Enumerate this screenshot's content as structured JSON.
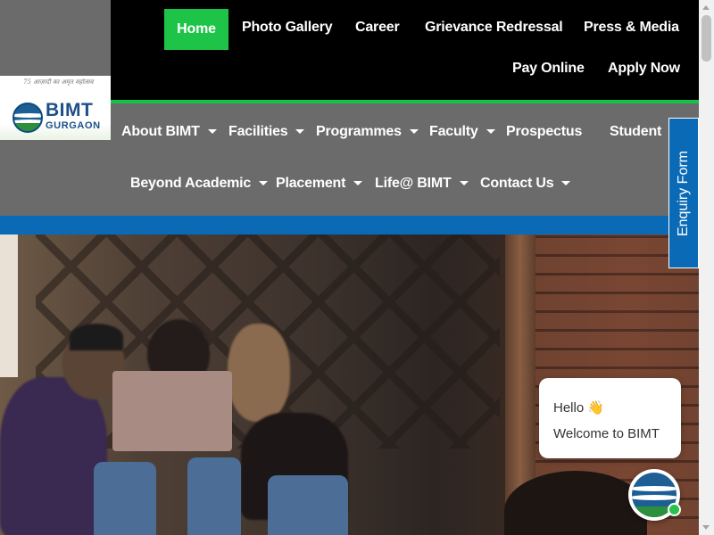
{
  "logo": {
    "tagline": "75 आज़ादी का अमृत महोत्सव",
    "name": "BIMT",
    "city": "GURGAON"
  },
  "top_nav": [
    {
      "label": "Home",
      "active": true
    },
    {
      "label": "Photo Gallery"
    },
    {
      "label": "Career"
    },
    {
      "label": "Grievance Redressal"
    },
    {
      "label": "Press & Media"
    },
    {
      "label": "Pay Online"
    },
    {
      "label": "Apply Now"
    }
  ],
  "main_nav": [
    {
      "label": "About BIMT",
      "dropdown": true
    },
    {
      "label": "Facilities",
      "dropdown": true
    },
    {
      "label": "Programmes",
      "dropdown": true
    },
    {
      "label": "Faculty",
      "dropdown": true
    },
    {
      "label": "Prospectus",
      "dropdown": false
    },
    {
      "label": "Student",
      "dropdown": true
    },
    {
      "label": "Beyond Academic",
      "dropdown": true
    },
    {
      "label": "Placement",
      "dropdown": true
    },
    {
      "label": "Life@ BIMT",
      "dropdown": true
    },
    {
      "label": "Contact Us",
      "dropdown": true
    }
  ],
  "enquiry_tab": "Enquiry Form",
  "chat": {
    "greeting": "Hello 👋",
    "welcome": "Welcome to BIMT"
  },
  "colors": {
    "active_green": "#1ec447",
    "nav_grey": "#6b6b6b",
    "brand_blue": "#0a6ab6"
  }
}
